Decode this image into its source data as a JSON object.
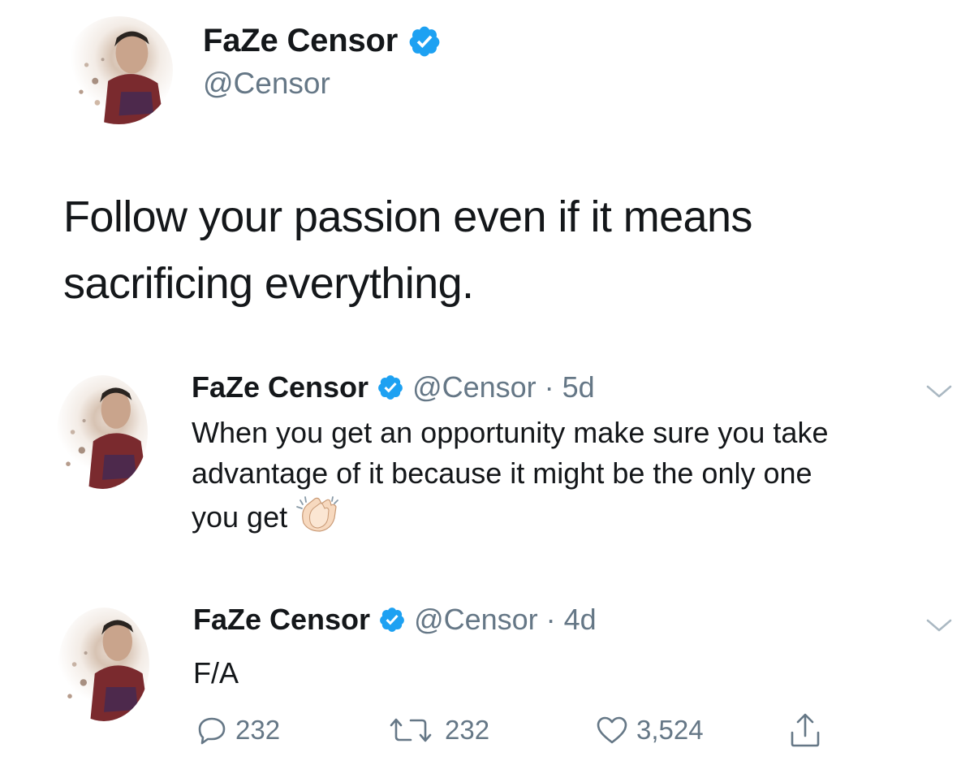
{
  "header": {
    "name": "FaZe Censor",
    "handle": "@Censor"
  },
  "main_tweet": {
    "line1": "Follow your passion even if it means",
    "line2": "sacrificing everything."
  },
  "thread": [
    {
      "name": "FaZe Censor",
      "handle_time": "@Censor · 5d",
      "line1": "When you get an opportunity make sure you take",
      "line2": "advantage of it because it might be the only one",
      "line3": "you get",
      "emoji": "clapping-hands-icon"
    },
    {
      "name": "FaZe Censor",
      "handle_time": "@Censor · 4d",
      "text": "F/A"
    }
  ],
  "actions": {
    "replies": "232",
    "retweets": "232",
    "likes": "3,524"
  },
  "colors": {
    "text": "#14171a",
    "secondary": "#657786",
    "verified": "#1da1f2"
  }
}
